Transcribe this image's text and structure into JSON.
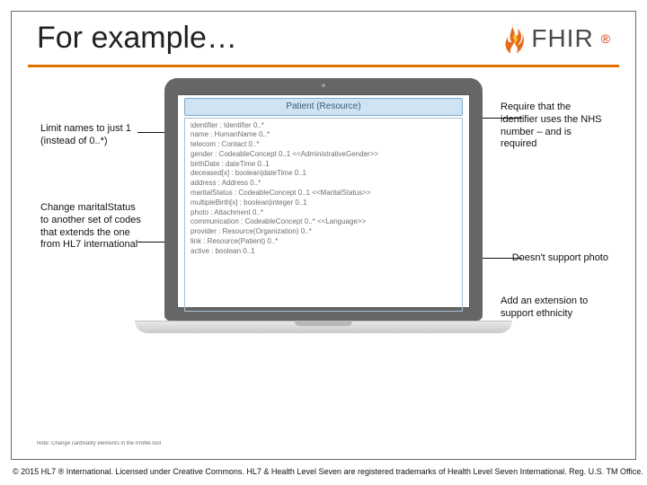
{
  "header": {
    "title": "For example…",
    "brand": "FHIR",
    "reg": "®"
  },
  "notes": {
    "left1": "Limit names to just 1 (instead of 0..*)",
    "left2": "Change maritalStatus to another set of codes that extends the one from HL7 international",
    "right1": "Require that the identifier uses the NHS number – and is required",
    "right2": "Doesn't support photo",
    "right3": "Add an extension to support ethnicity"
  },
  "screen": {
    "heading": "Patient (Resource)",
    "lines": [
      "identifier : Identifier 0..*",
      "name : HumanName 0..*",
      "telecom : Contact 0..*",
      "gender : CodeableConcept 0..1 <<AdministrativeGender>>",
      "birthDate : dateTime 0..1",
      "deceased[x] : boolean|dateTime 0..1",
      "address : Address 0..*",
      "maritalStatus : CodeableConcept 0..1 <<MaritalStatus>>",
      "multipleBirth[x] : boolean|integer 0..1",
      "photo : Attachment 0..*",
      "communication : CodeableConcept 0..* <<Language>>",
      "provider : Resource(Organization) 0..*",
      "link : Resource(Patient) 0..*",
      "active : boolean 0..1"
    ]
  },
  "footer": {
    "small": "Note: Change cardinality elements in the Profile tool",
    "copyright": "© 2015 HL7 ® International. Licensed under Creative Commons. HL7 & Health Level Seven are registered trademarks of Health Level Seven International. Reg. U.S. TM Office."
  }
}
